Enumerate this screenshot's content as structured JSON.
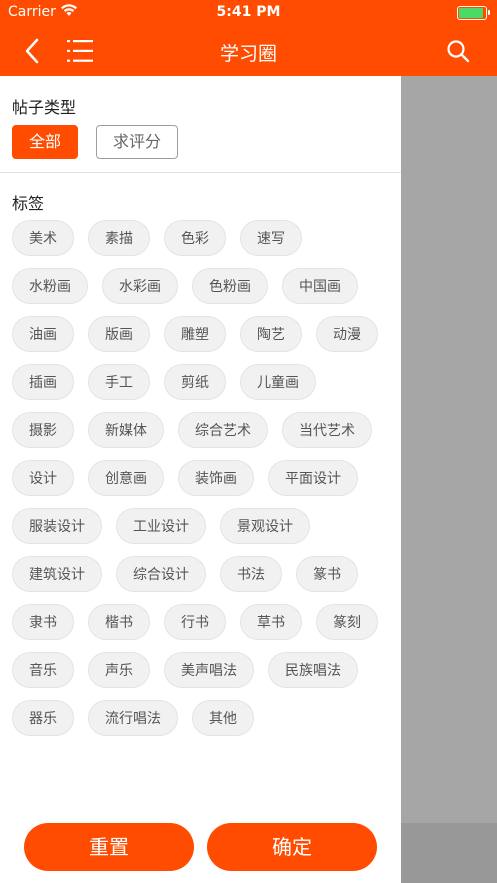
{
  "status_bar": {
    "carrier": "Carrier",
    "time": "5:41 PM",
    "battery_level": 1.0
  },
  "nav": {
    "title": "学习圈",
    "back_icon": "chevron-left-icon",
    "menu_icon": "list-icon",
    "search_icon": "search-icon"
  },
  "filter": {
    "post_type_title": "帖子类型",
    "post_types": [
      {
        "label": "全部",
        "selected": true
      },
      {
        "label": "求评分",
        "selected": false
      }
    ],
    "tags_title": "标签",
    "tag_rows": [
      [
        "美术",
        "素描",
        "色彩",
        "速写"
      ],
      [
        "水粉画",
        "水彩画",
        "色粉画",
        "中国画"
      ],
      [
        "油画",
        "版画",
        "雕塑",
        "陶艺",
        "动漫"
      ],
      [
        "插画",
        "手工",
        "剪纸",
        "儿童画"
      ],
      [
        "摄影",
        "新媒体",
        "综合艺术",
        "当代艺术"
      ],
      [
        "设计",
        "创意画",
        "装饰画",
        "平面设计"
      ],
      [
        "服装设计",
        "工业设计",
        "景观设计"
      ],
      [
        "建筑设计",
        "综合设计",
        "书法",
        "篆书"
      ],
      [
        "隶书",
        "楷书",
        "行书",
        "草书",
        "篆刻"
      ],
      [
        "音乐",
        "声乐",
        "美声唱法",
        "民族唱法"
      ],
      [
        "器乐",
        "流行唱法",
        "其他"
      ]
    ],
    "reset_label": "重置",
    "confirm_label": "确定"
  },
  "colors": {
    "accent": "#ff4c00",
    "overlay": "#a6a6a6"
  }
}
